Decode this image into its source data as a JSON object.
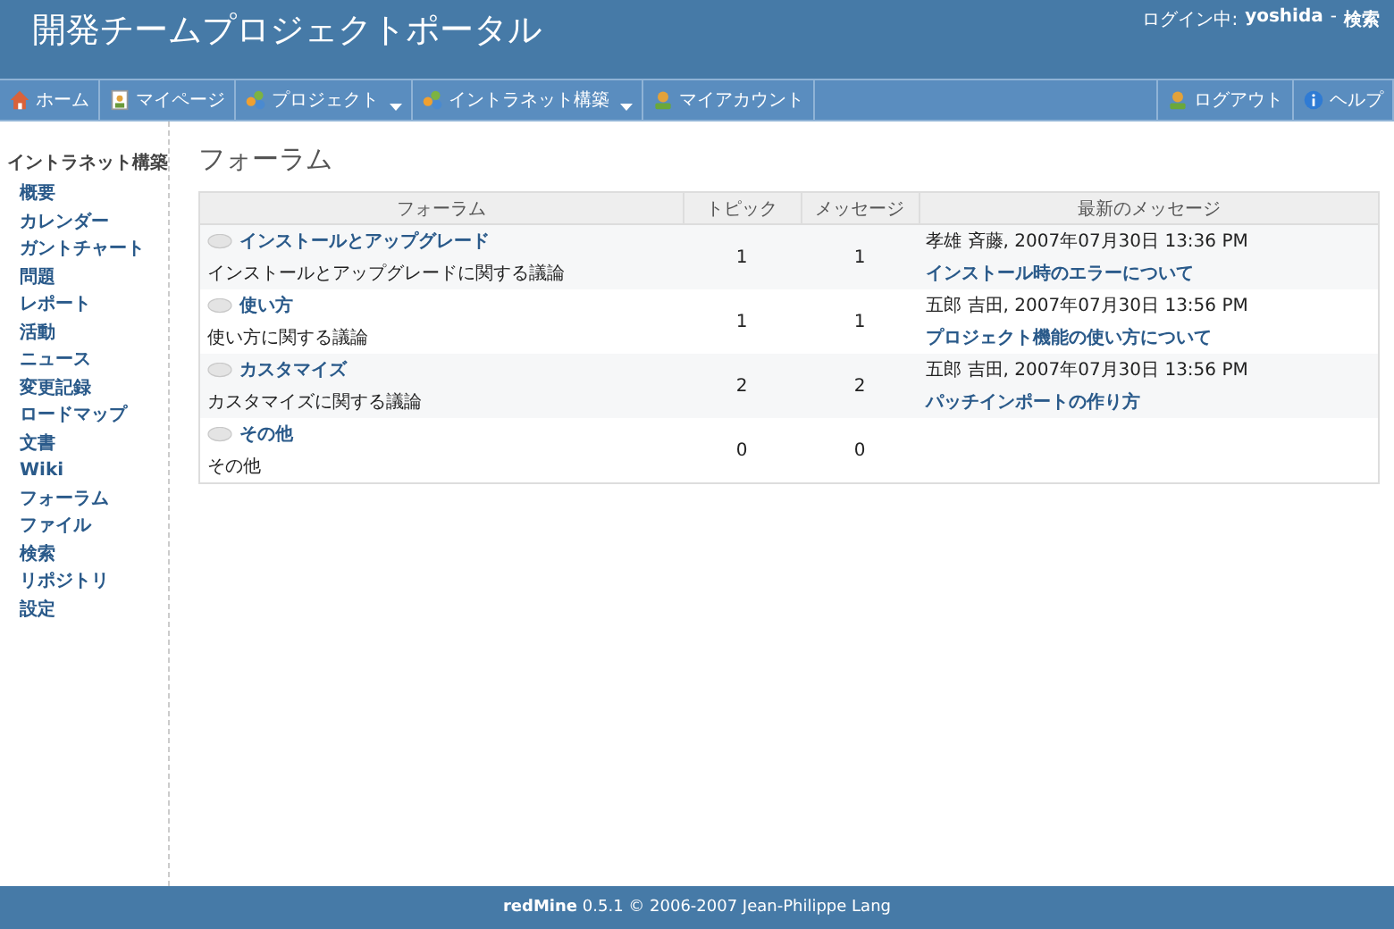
{
  "header": {
    "title": "開発チームプロジェクトポータル",
    "login_label": "ログイン中:",
    "username": "yoshida",
    "separator": "-",
    "search_link": "検索"
  },
  "menu_left": [
    {
      "label": "ホーム",
      "kind": "home",
      "dropdown": false
    },
    {
      "label": "マイページ",
      "kind": "page",
      "dropdown": false
    },
    {
      "label": "プロジェクト",
      "kind": "group",
      "dropdown": true
    },
    {
      "label": "イントラネット構築",
      "kind": "group",
      "dropdown": true
    },
    {
      "label": "マイアカウント",
      "kind": "user",
      "dropdown": false
    }
  ],
  "menu_right": [
    {
      "label": "ログアウト",
      "kind": "user",
      "dropdown": false
    },
    {
      "label": "ヘルプ",
      "kind": "info",
      "dropdown": false
    }
  ],
  "sidebar": {
    "title": "イントラネット構築",
    "items": [
      "概要",
      "カレンダー",
      "ガントチャート",
      "問題",
      "レポート",
      "活動",
      "ニュース",
      "変更記録",
      "ロードマップ",
      "文書",
      "Wiki",
      "フォーラム",
      "ファイル",
      "検索",
      "リポジトリ",
      "設定"
    ]
  },
  "page_title": "フォーラム",
  "table": {
    "columns": [
      "フォーラム",
      "トピック",
      "メッセージ",
      "最新のメッセージ"
    ],
    "rows": [
      {
        "name": "インストールとアップグレード",
        "description": "インストールとアップグレードに関する議論",
        "topics": "1",
        "messages": "1",
        "last_author": "孝雄 斉藤, 2007年07月30日 13:36 PM",
        "last_link": "インストール時のエラーについて"
      },
      {
        "name": "使い方",
        "description": "使い方に関する議論",
        "topics": "1",
        "messages": "1",
        "last_author": "五郎 吉田, 2007年07月30日 13:56 PM",
        "last_link": "プロジェクト機能の使い方について"
      },
      {
        "name": "カスタマイズ",
        "description": "カスタマイズに関する議論",
        "topics": "2",
        "messages": "2",
        "last_author": "五郎 吉田, 2007年07月30日 13:56 PM",
        "last_link": "パッチインポートの作り方"
      },
      {
        "name": "その他",
        "description": "その他",
        "topics": "0",
        "messages": "0"
      }
    ]
  },
  "footer": "**redMine** 0.5.1 © 2006-2007 Jean-Philippe Lang"
}
